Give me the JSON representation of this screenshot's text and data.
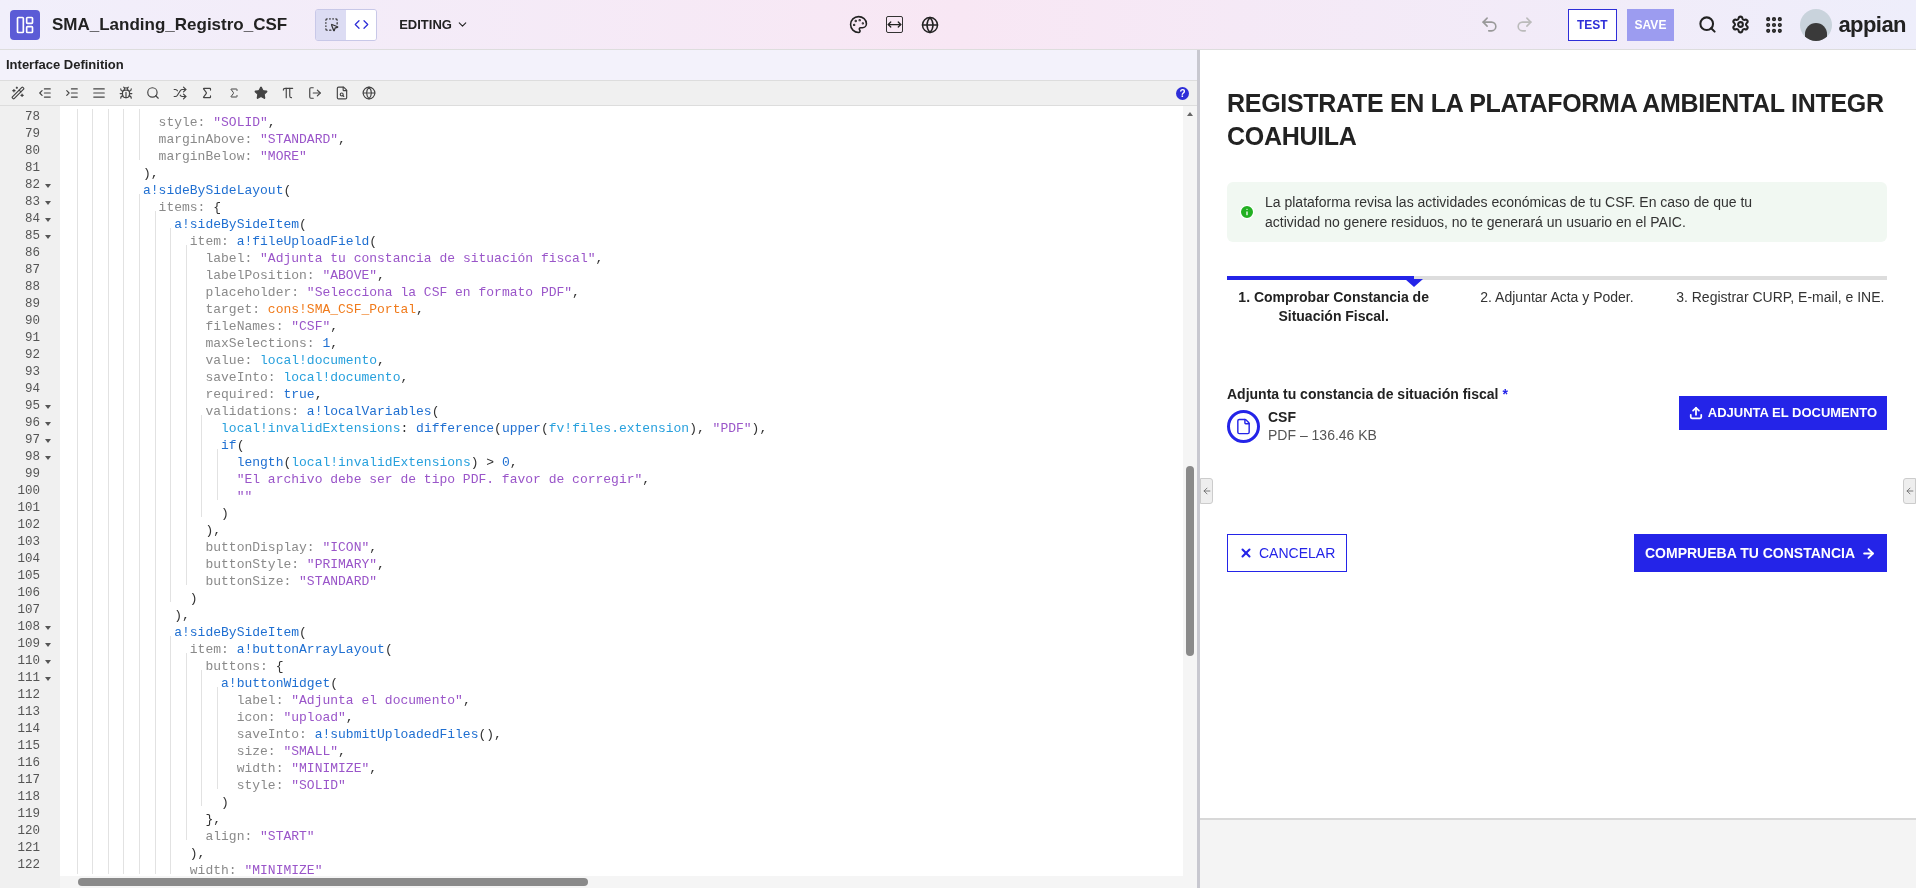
{
  "header": {
    "title": "SMA_Landing_Registro_CSF",
    "view_toggle": [
      {
        "kind": "design",
        "selected": true
      },
      {
        "kind": "code",
        "selected": false
      }
    ],
    "mode": "EDITING",
    "test": "TEST",
    "save": {
      "label": "SAVE",
      "disabled": true
    },
    "brand": "appian"
  },
  "editor": {
    "title": "Interface Definition",
    "help": "?",
    "lines": [
      {
        "number": "78",
        "foldable": false,
        "tokens": [
          {
            "kind": "key",
            "text": "            style: "
          },
          {
            "kind": "str",
            "text": "\"SOLID\""
          },
          {
            "kind": "punct",
            "text": ","
          }
        ]
      },
      {
        "number": "79",
        "foldable": false,
        "tokens": [
          {
            "kind": "key",
            "text": "            marginAbove: "
          },
          {
            "kind": "str",
            "text": "\"STANDARD\""
          },
          {
            "kind": "punct",
            "text": ","
          }
        ]
      },
      {
        "number": "80",
        "foldable": false,
        "tokens": [
          {
            "kind": "key",
            "text": "            marginBelow: "
          },
          {
            "kind": "str",
            "text": "\"MORE\""
          }
        ]
      },
      {
        "number": "81",
        "foldable": false,
        "tokens": [
          {
            "kind": "punct",
            "text": "          ),"
          }
        ]
      },
      {
        "number": "82",
        "foldable": true,
        "tokens": [
          {
            "kind": "fn",
            "text": "          a!sideBySideLayout"
          },
          {
            "kind": "punct",
            "text": "("
          }
        ]
      },
      {
        "number": "83",
        "foldable": true,
        "tokens": [
          {
            "kind": "key",
            "text": "            items: "
          },
          {
            "kind": "punct",
            "text": "{"
          }
        ]
      },
      {
        "number": "84",
        "foldable": true,
        "tokens": [
          {
            "kind": "fn",
            "text": "              a!sideBySideItem"
          },
          {
            "kind": "punct",
            "text": "("
          }
        ]
      },
      {
        "number": "85",
        "foldable": true,
        "tokens": [
          {
            "kind": "key",
            "text": "                item: "
          },
          {
            "kind": "fn",
            "text": "a!fileUploadField"
          },
          {
            "kind": "punct",
            "text": "("
          }
        ]
      },
      {
        "number": "86",
        "foldable": false,
        "tokens": [
          {
            "kind": "key",
            "text": "                  label: "
          },
          {
            "kind": "str",
            "text": "\"Adjunta tu constancia de situación fiscal\""
          },
          {
            "kind": "punct",
            "text": ","
          }
        ]
      },
      {
        "number": "87",
        "foldable": false,
        "tokens": [
          {
            "kind": "key",
            "text": "                  labelPosition: "
          },
          {
            "kind": "str",
            "text": "\"ABOVE\""
          },
          {
            "kind": "punct",
            "text": ","
          }
        ]
      },
      {
        "number": "88",
        "foldable": false,
        "tokens": [
          {
            "kind": "key",
            "text": "                  placeholder: "
          },
          {
            "kind": "str",
            "text": "\"Selecciona la CSF en formato PDF\""
          },
          {
            "kind": "punct",
            "text": ","
          }
        ]
      },
      {
        "number": "89",
        "foldable": false,
        "tokens": [
          {
            "kind": "key",
            "text": "                  target: "
          },
          {
            "kind": "const",
            "text": "cons!SMA_CSF_Portal"
          },
          {
            "kind": "punct",
            "text": ","
          }
        ]
      },
      {
        "number": "90",
        "foldable": false,
        "tokens": [
          {
            "kind": "key",
            "text": "                  fileNames: "
          },
          {
            "kind": "str",
            "text": "\"CSF\""
          },
          {
            "kind": "punct",
            "text": ","
          }
        ]
      },
      {
        "number": "91",
        "foldable": false,
        "tokens": [
          {
            "kind": "key",
            "text": "                  maxSelections: "
          },
          {
            "kind": "num",
            "text": "1"
          },
          {
            "kind": "punct",
            "text": ","
          }
        ]
      },
      {
        "number": "92",
        "foldable": false,
        "tokens": [
          {
            "kind": "key",
            "text": "                  value: "
          },
          {
            "kind": "var",
            "text": "local!documento"
          },
          {
            "kind": "punct",
            "text": ","
          }
        ]
      },
      {
        "number": "93",
        "foldable": false,
        "tokens": [
          {
            "kind": "key",
            "text": "                  saveInto: "
          },
          {
            "kind": "var",
            "text": "local!documento"
          },
          {
            "kind": "punct",
            "text": ","
          }
        ]
      },
      {
        "number": "94",
        "foldable": false,
        "tokens": [
          {
            "kind": "key",
            "text": "                  required: "
          },
          {
            "kind": "num",
            "text": "true"
          },
          {
            "kind": "punct",
            "text": ","
          }
        ]
      },
      {
        "number": "95",
        "foldable": true,
        "tokens": [
          {
            "kind": "key",
            "text": "                  validations: "
          },
          {
            "kind": "fn",
            "text": "a!localVariables"
          },
          {
            "kind": "punct",
            "text": "("
          }
        ]
      },
      {
        "number": "96",
        "foldable": true,
        "tokens": [
          {
            "kind": "var",
            "text": "                    local!invalidExtensions"
          },
          {
            "kind": "punct",
            "text": ": "
          },
          {
            "kind": "fn",
            "text": "difference"
          },
          {
            "kind": "punct",
            "text": "("
          },
          {
            "kind": "fn",
            "text": "upper"
          },
          {
            "kind": "punct",
            "text": "("
          },
          {
            "kind": "var",
            "text": "fv!files.extension"
          },
          {
            "kind": "punct",
            "text": "), "
          },
          {
            "kind": "str",
            "text": "\"PDF\""
          },
          {
            "kind": "punct",
            "text": "),"
          }
        ]
      },
      {
        "number": "97",
        "foldable": true,
        "tokens": [
          {
            "kind": "fn",
            "text": "                    if"
          },
          {
            "kind": "punct",
            "text": "("
          }
        ]
      },
      {
        "number": "98",
        "foldable": true,
        "tokens": [
          {
            "kind": "fn",
            "text": "                      length"
          },
          {
            "kind": "punct",
            "text": "("
          },
          {
            "kind": "var",
            "text": "local!invalidExtensions"
          },
          {
            "kind": "punct",
            "text": ") > "
          },
          {
            "kind": "num",
            "text": "0"
          },
          {
            "kind": "punct",
            "text": ","
          }
        ]
      },
      {
        "number": "99",
        "foldable": false,
        "tokens": [
          {
            "kind": "str",
            "text": "                      \"El archivo debe ser de tipo PDF. favor de corregir\""
          },
          {
            "kind": "punct",
            "text": ","
          }
        ]
      },
      {
        "number": "100",
        "foldable": false,
        "tokens": [
          {
            "kind": "str",
            "text": "                      \"\""
          }
        ]
      },
      {
        "number": "101",
        "foldable": false,
        "tokens": [
          {
            "kind": "punct",
            "text": "                    )"
          }
        ]
      },
      {
        "number": "102",
        "foldable": false,
        "tokens": [
          {
            "kind": "punct",
            "text": "                  ),"
          }
        ]
      },
      {
        "number": "103",
        "foldable": false,
        "tokens": [
          {
            "kind": "key",
            "text": "                  buttonDisplay: "
          },
          {
            "kind": "str",
            "text": "\"ICON\""
          },
          {
            "kind": "punct",
            "text": ","
          }
        ]
      },
      {
        "number": "104",
        "foldable": false,
        "tokens": [
          {
            "kind": "key",
            "text": "                  buttonStyle: "
          },
          {
            "kind": "str",
            "text": "\"PRIMARY\""
          },
          {
            "kind": "punct",
            "text": ","
          }
        ]
      },
      {
        "number": "105",
        "foldable": false,
        "tokens": [
          {
            "kind": "key",
            "text": "                  buttonSize: "
          },
          {
            "kind": "str",
            "text": "\"STANDARD\""
          }
        ]
      },
      {
        "number": "106",
        "foldable": false,
        "tokens": [
          {
            "kind": "punct",
            "text": "                )"
          }
        ]
      },
      {
        "number": "107",
        "foldable": false,
        "tokens": [
          {
            "kind": "punct",
            "text": "              ),"
          }
        ]
      },
      {
        "number": "108",
        "foldable": true,
        "tokens": [
          {
            "kind": "fn",
            "text": "              a!sideBySideItem"
          },
          {
            "kind": "punct",
            "text": "("
          }
        ]
      },
      {
        "number": "109",
        "foldable": true,
        "tokens": [
          {
            "kind": "key",
            "text": "                item: "
          },
          {
            "kind": "fn",
            "text": "a!buttonArrayLayout"
          },
          {
            "kind": "punct",
            "text": "("
          }
        ]
      },
      {
        "number": "110",
        "foldable": true,
        "tokens": [
          {
            "kind": "key",
            "text": "                  buttons: "
          },
          {
            "kind": "punct",
            "text": "{"
          }
        ]
      },
      {
        "number": "111",
        "foldable": true,
        "tokens": [
          {
            "kind": "fn",
            "text": "                    a!buttonWidget"
          },
          {
            "kind": "punct",
            "text": "("
          }
        ]
      },
      {
        "number": "112",
        "foldable": false,
        "tokens": [
          {
            "kind": "key",
            "text": "                      label: "
          },
          {
            "kind": "str",
            "text": "\"Adjunta el documento\""
          },
          {
            "kind": "punct",
            "text": ","
          }
        ]
      },
      {
        "number": "113",
        "foldable": false,
        "tokens": [
          {
            "kind": "key",
            "text": "                      icon: "
          },
          {
            "kind": "str",
            "text": "\"upload\""
          },
          {
            "kind": "punct",
            "text": ","
          }
        ]
      },
      {
        "number": "114",
        "foldable": false,
        "tokens": [
          {
            "kind": "key",
            "text": "                      saveInto: "
          },
          {
            "kind": "fn",
            "text": "a!submitUploadedFiles"
          },
          {
            "kind": "punct",
            "text": "(),"
          }
        ]
      },
      {
        "number": "115",
        "foldable": false,
        "tokens": [
          {
            "kind": "key",
            "text": "                      size: "
          },
          {
            "kind": "str",
            "text": "\"SMALL\""
          },
          {
            "kind": "punct",
            "text": ","
          }
        ]
      },
      {
        "number": "116",
        "foldable": false,
        "tokens": [
          {
            "kind": "key",
            "text": "                      width: "
          },
          {
            "kind": "str",
            "text": "\"MINIMIZE\""
          },
          {
            "kind": "punct",
            "text": ","
          }
        ]
      },
      {
        "number": "117",
        "foldable": false,
        "tokens": [
          {
            "kind": "key",
            "text": "                      style: "
          },
          {
            "kind": "str",
            "text": "\"SOLID\""
          }
        ]
      },
      {
        "number": "118",
        "foldable": false,
        "tokens": [
          {
            "kind": "punct",
            "text": "                    )"
          }
        ]
      },
      {
        "number": "119",
        "foldable": false,
        "tokens": [
          {
            "kind": "punct",
            "text": "                  },"
          }
        ]
      },
      {
        "number": "120",
        "foldable": false,
        "tokens": [
          {
            "kind": "key",
            "text": "                  align: "
          },
          {
            "kind": "str",
            "text": "\"START\""
          }
        ]
      },
      {
        "number": "121",
        "foldable": false,
        "tokens": [
          {
            "kind": "punct",
            "text": "                ),"
          }
        ]
      },
      {
        "number": "122",
        "foldable": false,
        "tokens": [
          {
            "kind": "key",
            "text": "                width: "
          },
          {
            "kind": "str",
            "text": "\"MINIMIZE\""
          }
        ]
      }
    ]
  },
  "preview": {
    "title_lines": [
      "REGISTRATE EN LA PLATAFORMA AMBIENTAL INTEGR",
      "COAHUILA"
    ],
    "info": "La plataforma revisa las actividades económicas de tu CSF. En caso de que tu actividad no genere residuos, no te generará un usuario en el PAIC.",
    "steps": [
      {
        "label": "1. Comprobar Constancia de Situación Fiscal.",
        "selected": true
      },
      {
        "label": "2. Adjuntar Acta y Poder.",
        "selected": false
      },
      {
        "label": "3. Registrar CURP, E-mail, e INE.",
        "selected": false
      }
    ],
    "upload": {
      "label": "Adjunta tu constancia de situación fiscal",
      "required_mark": "*",
      "file_name": "CSF",
      "file_meta": "PDF – 136.46 KB",
      "button": "ADJUNTA EL DOCUMENTO"
    },
    "cancel": "CANCELAR",
    "submit": "COMPRUEBA TU CONSTANCIA"
  }
}
